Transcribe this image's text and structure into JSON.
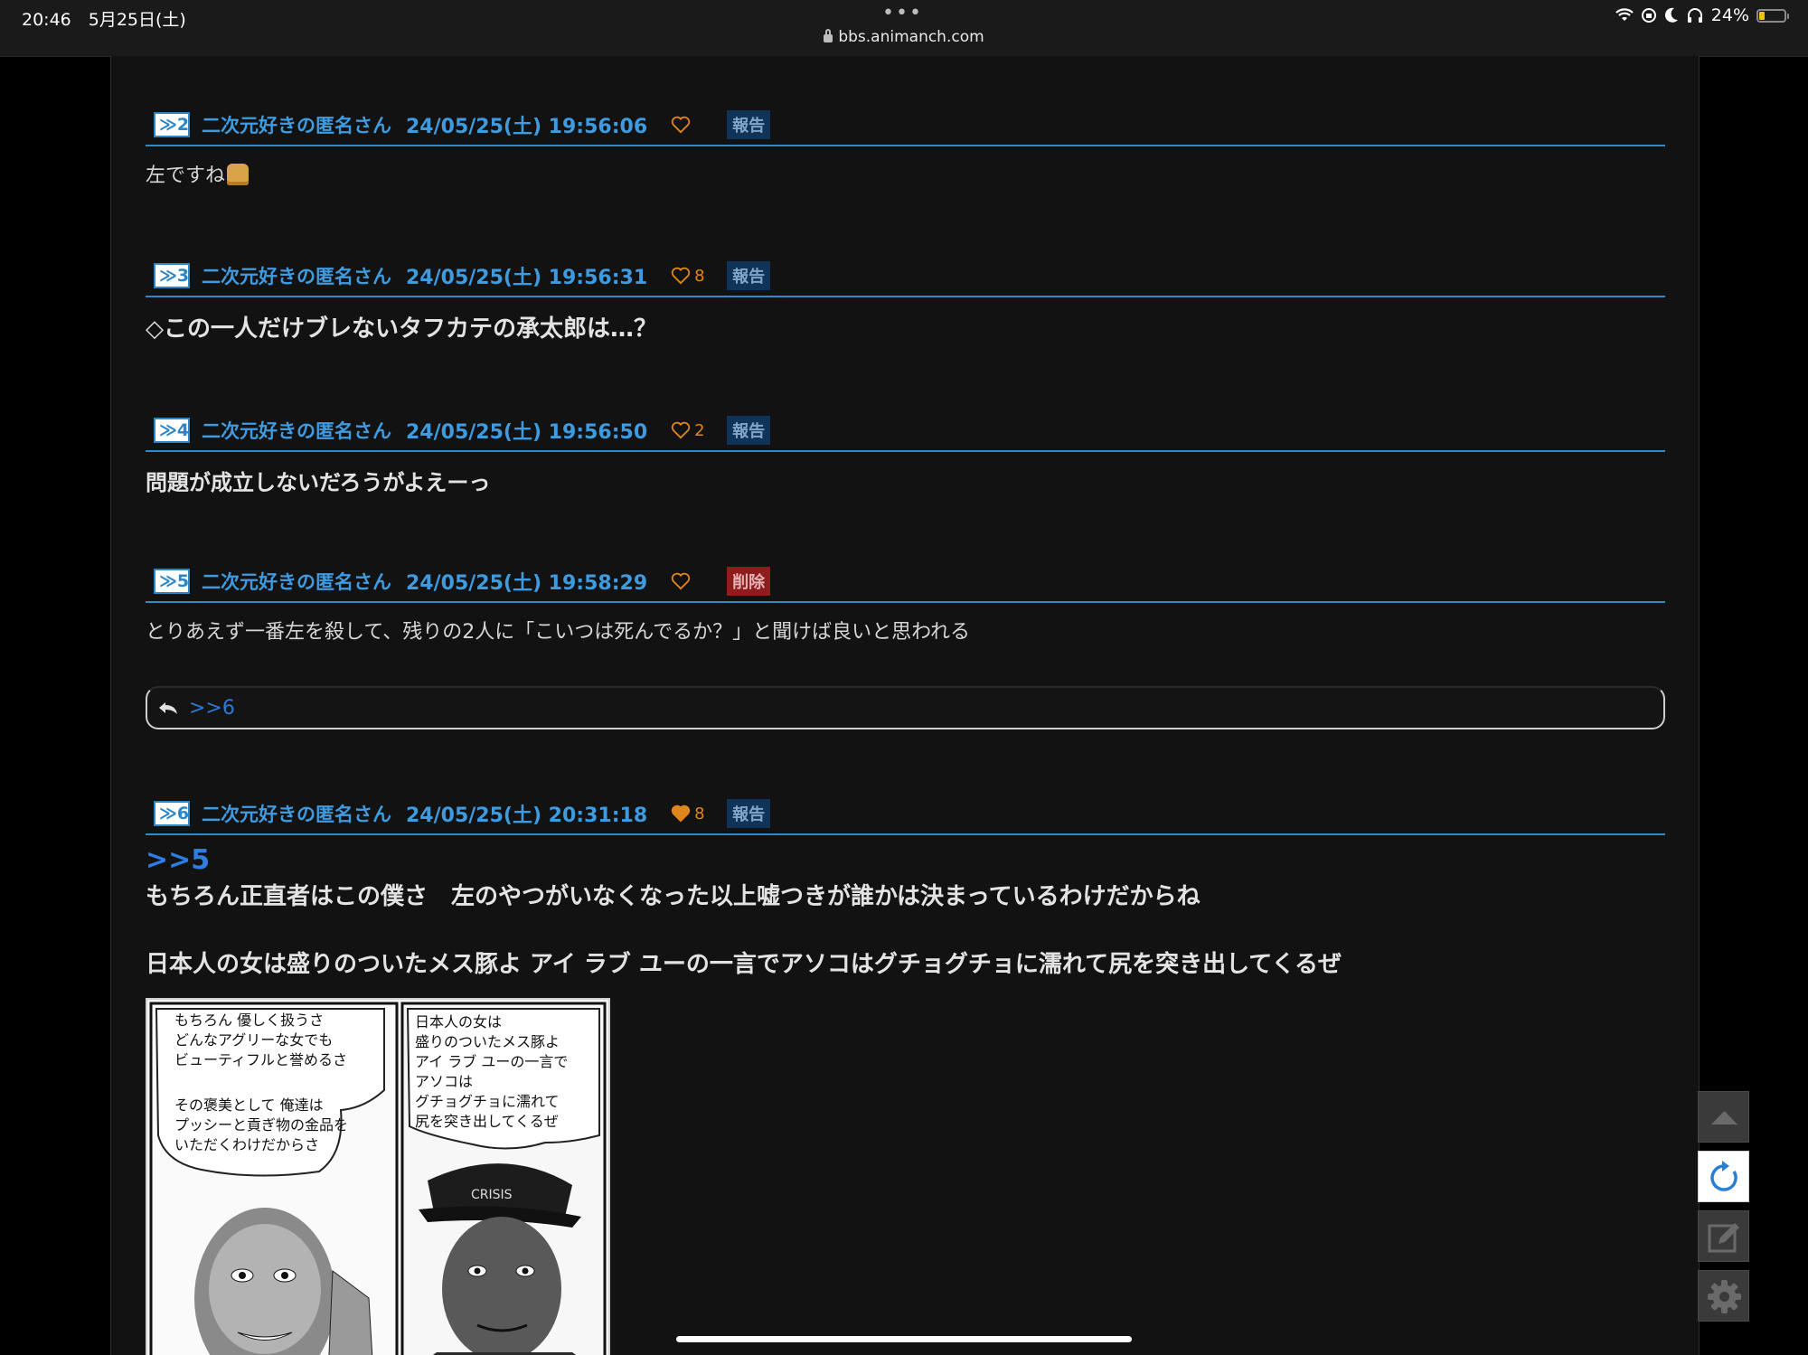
{
  "status_bar": {
    "time_date": "20:46　5月25日(土)",
    "dots": "•••",
    "url": "bbs.animanch.com",
    "battery_percent": "24%",
    "battery_level": 0.24,
    "icons": [
      "wifi-icon",
      "orientation-lock-icon",
      "moon-icon",
      "headphones-icon",
      "battery-icon"
    ]
  },
  "posts": [
    {
      "num": "≫2",
      "author": "二次元好きの匿名さん",
      "date": "24/05/25(土) 19:56:06",
      "likes": "",
      "liked": false,
      "badge": "報告",
      "badge_type": "report",
      "body": "左ですね"
    },
    {
      "num": "≫3",
      "author": "二次元好きの匿名さん",
      "date": "24/05/25(土) 19:56:31",
      "likes": "8",
      "liked": false,
      "badge": "報告",
      "badge_type": "report",
      "body": "◇この一人だけブレないタフカテの承太郎は…？"
    },
    {
      "num": "≫4",
      "author": "二次元好きの匿名さん",
      "date": "24/05/25(土) 19:56:50",
      "likes": "2",
      "liked": false,
      "badge": "報告",
      "badge_type": "report",
      "body": "問題が成立しないだろうがよえーっ"
    },
    {
      "num": "≫5",
      "author": "二次元好きの匿名さん",
      "date": "24/05/25(土) 19:58:29",
      "likes": "",
      "liked": false,
      "badge": "削除",
      "badge_type": "delete",
      "body": "とりあえず一番左を殺して、残りの2人に「こいつは死んでるか？」と聞けば良いと思われる"
    },
    {
      "num": "≫6",
      "author": "二次元好きの匿名さん",
      "date": "24/05/25(土) 20:31:18",
      "likes": "8",
      "liked": true,
      "badge": "報告",
      "badge_type": "report",
      "anchor": ">>5",
      "body_line1": "もちろん正直者はこの僕さ　左のやつがいなくなった以上嘘つきが誰かは決まっているわけだからね",
      "body_line2": "日本人の女は盛りのついたメス豚よ アイ ラブ ユーの一言でアソコはグチョグチョに濡れて尻を突き出してくるぜ"
    }
  ],
  "reply_bar": {
    "link": ">>6"
  },
  "manga_image": {
    "panel_left_text": [
      "もちろん 優しく扱うさ",
      "どんなアグリーな女でも",
      "ビューティフルと誉めるさ",
      "",
      "その褒美として 俺達は",
      "プッシーと貢ぎ物の金品を",
      "いただくわけだからさ"
    ],
    "panel_right_text": [
      "日本人の女は",
      "盛りのついたメス豚よ",
      "アイ ラブ ユーの一言で",
      "アソコは",
      "グチョグチョに濡れて",
      "尻を突き出してくるぜ"
    ],
    "cap_text": "CRISIS"
  },
  "side_buttons": [
    "scroll-top-button",
    "reload-button",
    "write-button",
    "settings-button"
  ],
  "colors": {
    "accent_blue": "#3f9be0",
    "header_rule": "#2d8bc9",
    "heart_orange": "#e0851a",
    "report_badge": "#0f3458",
    "delete_badge": "#8f1c1c",
    "page_bg": "#121213"
  }
}
